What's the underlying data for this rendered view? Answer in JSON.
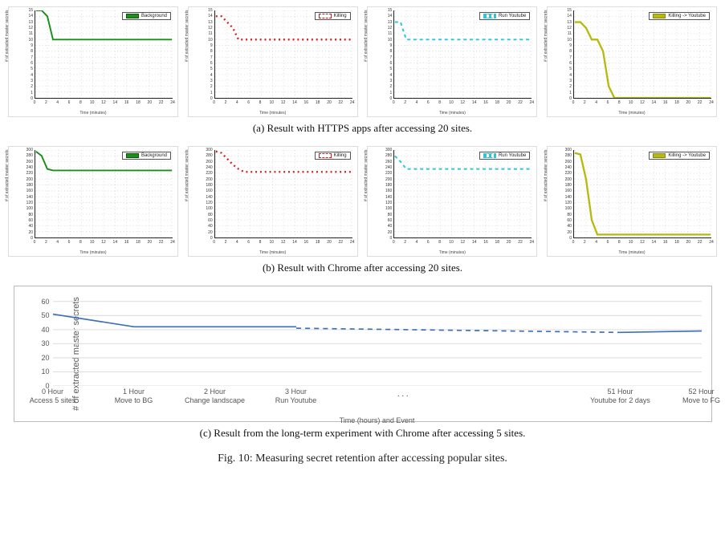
{
  "chart_data": [
    {
      "id": "a1",
      "type": "line",
      "group": "a",
      "legend": "Background",
      "color": "green",
      "xlabel": "Time (minutes)",
      "ylabel": "# of extracted master secrets",
      "xlim": [
        0,
        24
      ],
      "ylim": [
        0,
        15
      ],
      "yticks": [
        0,
        1,
        2,
        3,
        4,
        5,
        6,
        7,
        8,
        9,
        10,
        11,
        12,
        13,
        14,
        15
      ],
      "xticks": [
        0,
        2,
        4,
        6,
        8,
        10,
        12,
        14,
        16,
        18,
        20,
        22,
        24
      ],
      "x": [
        0,
        1,
        2,
        3,
        4,
        24
      ],
      "y": [
        15,
        15,
        14,
        10,
        10,
        10
      ]
    },
    {
      "id": "a2",
      "type": "line",
      "group": "a",
      "legend": "Killing",
      "color": "red",
      "xlabel": "Time (minutes)",
      "ylabel": "# of extracted master secrets",
      "xlim": [
        0,
        24
      ],
      "ylim": [
        0,
        15
      ],
      "yticks": [
        0,
        1,
        2,
        3,
        4,
        5,
        6,
        7,
        8,
        9,
        10,
        11,
        12,
        13,
        14,
        15
      ],
      "xticks": [
        0,
        2,
        4,
        6,
        8,
        10,
        12,
        14,
        16,
        18,
        20,
        22,
        24
      ],
      "x": [
        0,
        1,
        2,
        3,
        4,
        5,
        24
      ],
      "y": [
        14,
        14,
        13,
        12,
        10,
        10,
        10
      ]
    },
    {
      "id": "a3",
      "type": "line",
      "group": "a",
      "legend": "Run Youtube",
      "color": "cyan",
      "xlabel": "Time (minutes)",
      "ylabel": "# of extracted master secrets",
      "xlim": [
        0,
        24
      ],
      "ylim": [
        0,
        15
      ],
      "yticks": [
        0,
        1,
        2,
        3,
        4,
        5,
        6,
        7,
        8,
        9,
        10,
        11,
        12,
        13,
        14,
        15
      ],
      "xticks": [
        0,
        2,
        4,
        6,
        8,
        10,
        12,
        14,
        16,
        18,
        20,
        22,
        24
      ],
      "x": [
        0,
        1,
        2,
        24
      ],
      "y": [
        13,
        13,
        10,
        10
      ]
    },
    {
      "id": "a4",
      "type": "line",
      "group": "a",
      "legend": "Killing -> Youtube",
      "color": "olive",
      "xlabel": "Time (minutes)",
      "ylabel": "# of extracted master secrets",
      "xlim": [
        0,
        24
      ],
      "ylim": [
        0,
        15
      ],
      "yticks": [
        0,
        1,
        2,
        3,
        4,
        5,
        6,
        7,
        8,
        9,
        10,
        11,
        12,
        13,
        14,
        15
      ],
      "xticks": [
        0,
        2,
        4,
        6,
        8,
        10,
        12,
        14,
        16,
        18,
        20,
        22,
        24
      ],
      "x": [
        0,
        1,
        2,
        3,
        4,
        5,
        6,
        7,
        24
      ],
      "y": [
        13,
        13,
        12,
        10,
        10,
        8,
        2,
        0,
        0
      ]
    },
    {
      "id": "b1",
      "type": "line",
      "group": "b",
      "legend": "Background",
      "color": "green",
      "xlabel": "Time (minutes)",
      "ylabel": "# of extracted master secrets",
      "xlim": [
        0,
        24
      ],
      "ylim": [
        0,
        300
      ],
      "yticks": [
        0,
        20,
        40,
        60,
        80,
        100,
        120,
        140,
        160,
        180,
        200,
        220,
        240,
        260,
        280,
        300
      ],
      "xticks": [
        0,
        2,
        4,
        6,
        8,
        10,
        12,
        14,
        16,
        18,
        20,
        22,
        24
      ],
      "x": [
        0,
        1,
        2,
        3,
        24
      ],
      "y": [
        295,
        280,
        235,
        230,
        230
      ]
    },
    {
      "id": "b2",
      "type": "line",
      "group": "b",
      "legend": "Killing",
      "color": "red",
      "xlabel": "Time (minutes)",
      "ylabel": "# of extracted master secrets",
      "xlim": [
        0,
        24
      ],
      "ylim": [
        0,
        300
      ],
      "yticks": [
        0,
        20,
        40,
        60,
        80,
        100,
        120,
        140,
        160,
        180,
        200,
        220,
        240,
        260,
        280,
        300
      ],
      "xticks": [
        0,
        2,
        4,
        6,
        8,
        10,
        12,
        14,
        16,
        18,
        20,
        22,
        24
      ],
      "x": [
        0,
        1,
        2,
        3,
        4,
        5,
        24
      ],
      "y": [
        295,
        290,
        270,
        250,
        235,
        225,
        225
      ]
    },
    {
      "id": "b3",
      "type": "line",
      "group": "b",
      "legend": "Run Youtube",
      "color": "cyan",
      "xlabel": "Time (minutes)",
      "ylabel": "# of extracted master secrets",
      "xlim": [
        0,
        24
      ],
      "ylim": [
        0,
        300
      ],
      "yticks": [
        0,
        20,
        40,
        60,
        80,
        100,
        120,
        140,
        160,
        180,
        200,
        220,
        240,
        260,
        280,
        300
      ],
      "xticks": [
        0,
        2,
        4,
        6,
        8,
        10,
        12,
        14,
        16,
        18,
        20,
        22,
        24
      ],
      "x": [
        0,
        1,
        2,
        24
      ],
      "y": [
        280,
        260,
        235,
        235
      ]
    },
    {
      "id": "b4",
      "type": "line",
      "group": "b",
      "legend": "Killing -> Youtube",
      "color": "olive",
      "xlabel": "Time (minutes)",
      "ylabel": "# of extracted master secrets",
      "xlim": [
        0,
        24
      ],
      "ylim": [
        0,
        300
      ],
      "yticks": [
        0,
        20,
        40,
        60,
        80,
        100,
        120,
        140,
        160,
        180,
        200,
        220,
        240,
        260,
        280,
        300
      ],
      "xticks": [
        0,
        2,
        4,
        6,
        8,
        10,
        12,
        14,
        16,
        18,
        20,
        22,
        24
      ],
      "x": [
        0,
        1,
        2,
        3,
        4,
        24
      ],
      "y": [
        290,
        285,
        200,
        60,
        10,
        10
      ]
    },
    {
      "id": "c",
      "type": "line",
      "group": "c",
      "legend": "",
      "color": "blue",
      "xlabel": "Time (hours) and Event",
      "ylabel": "# of extracted master secrets",
      "ylim": [
        0,
        65
      ],
      "yticks": [
        0,
        10,
        20,
        30,
        40,
        50,
        60
      ],
      "x_categories": [
        "0 Hour\nAccess 5 sites",
        "1 Hour\nMove to BG",
        "2 Hour\nChange landscape",
        "3 Hour\nRun Youtube",
        "",
        "",
        "",
        "51 Hour\nYoutube for 2 days",
        "52 Hour\nMove to FG"
      ],
      "segments": [
        {
          "dash": false,
          "x": [
            0,
            1,
            2,
            3
          ],
          "y": [
            51,
            42,
            42,
            42
          ]
        },
        {
          "dash": true,
          "x": [
            3,
            7
          ],
          "y": [
            41,
            38
          ]
        },
        {
          "dash": false,
          "x": [
            7,
            8
          ],
          "y": [
            38,
            39
          ]
        }
      ]
    }
  ],
  "captions": {
    "a": "(a) Result with HTTPS apps after accessing 20 sites.",
    "b": "(b) Result with Chrome after accessing 20 sites.",
    "c": "(c) Result from the long-term experiment with Chrome after accessing 5 sites.",
    "fig": "Fig. 10: Measuring secret retention after accessing popular sites."
  },
  "ellipsis": ". . ."
}
